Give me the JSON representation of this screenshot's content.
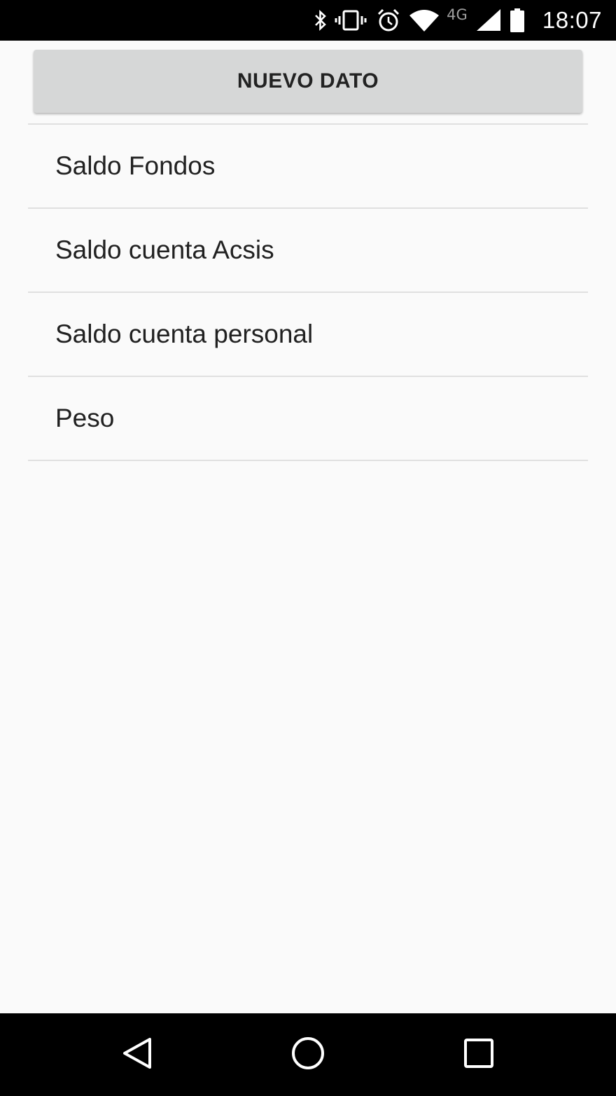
{
  "status_bar": {
    "time": "18:07",
    "network_type": "4G",
    "icons": [
      "bluetooth-icon",
      "vibrate-icon",
      "alarm-icon",
      "wifi-icon",
      "network-type-icon",
      "signal-icon",
      "battery-icon"
    ]
  },
  "toolbar": {
    "new_button_label": "NUEVO DATO"
  },
  "list": {
    "items": [
      {
        "label": "Saldo Fondos"
      },
      {
        "label": "Saldo cuenta Acsis"
      },
      {
        "label": "Saldo cuenta personal"
      },
      {
        "label": "Peso"
      }
    ]
  },
  "nav_bar": {
    "icons": [
      "back-icon",
      "home-icon",
      "recents-icon"
    ]
  },
  "colors": {
    "status_bar_bg": "#000000",
    "background": "#fafafa",
    "button_bg": "#d6d7d7",
    "divider": "#e0e0e0",
    "text": "#212121"
  }
}
